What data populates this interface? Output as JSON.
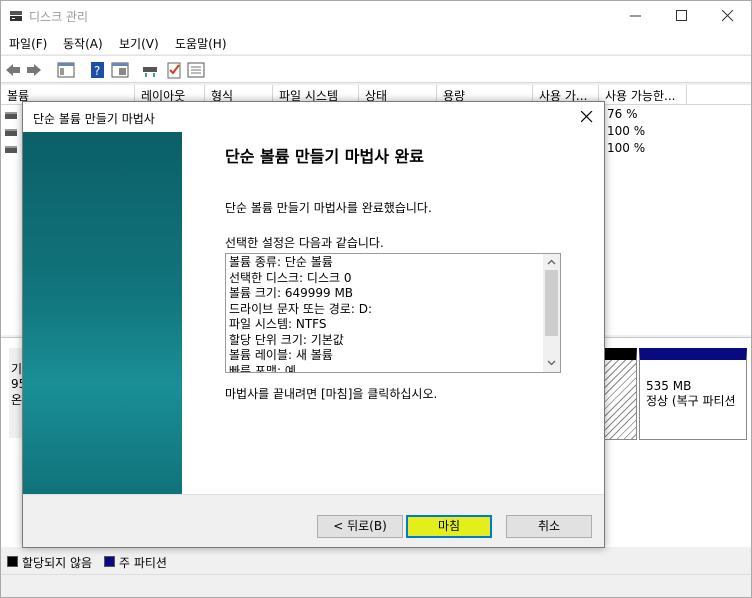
{
  "window": {
    "title": "디스크 관리",
    "menu": [
      "파일(F)",
      "동작(A)",
      "보기(V)",
      "도움말(H)"
    ]
  },
  "volume_list": {
    "columns": [
      "볼륨",
      "레이아웃",
      "형식",
      "파일 시스템",
      "상태",
      "용량",
      "사용 가...",
      "사용 가능한..."
    ],
    "rows_free_pct": [
      "76 %",
      "100 %",
      "100 %"
    ]
  },
  "disk_graph": {
    "label_lines": [
      "기",
      "95",
      "온"
    ],
    "partition": {
      "size": "535 MB",
      "status": "정상 (복구 파티션"
    }
  },
  "legend": [
    {
      "color": "#000000",
      "label": "할당되지 않음"
    },
    {
      "color": "#0a0a80",
      "label": "주 파티션"
    }
  ],
  "wizard": {
    "title": "단순 볼륨 만들기 마법사",
    "heading": "단순 볼륨 만들기 마법사 완료",
    "completed_text": "단순 볼륨 만들기 마법사를 완료했습니다.",
    "settings_label": "선택한 설정은 다음과 같습니다.",
    "settings": [
      "볼륨 종류: 단순 볼륨",
      "선택한 디스크: 디스크 0",
      "볼륨 크기: 649999 MB",
      "드라이브 문자 또는 경로: D:",
      "파일 시스템: NTFS",
      "할당 단위 크기: 기본값",
      "볼륨 레이블: 새 볼륨",
      "빠른 포맷: 예"
    ],
    "finish_hint": "마법사를 끝내려면 [마침]을 클릭하십시오.",
    "buttons": {
      "back": "< 뒤로(B)",
      "finish": "마침",
      "cancel": "취소"
    },
    "finish_highlight_color": "#e3ee1a"
  }
}
